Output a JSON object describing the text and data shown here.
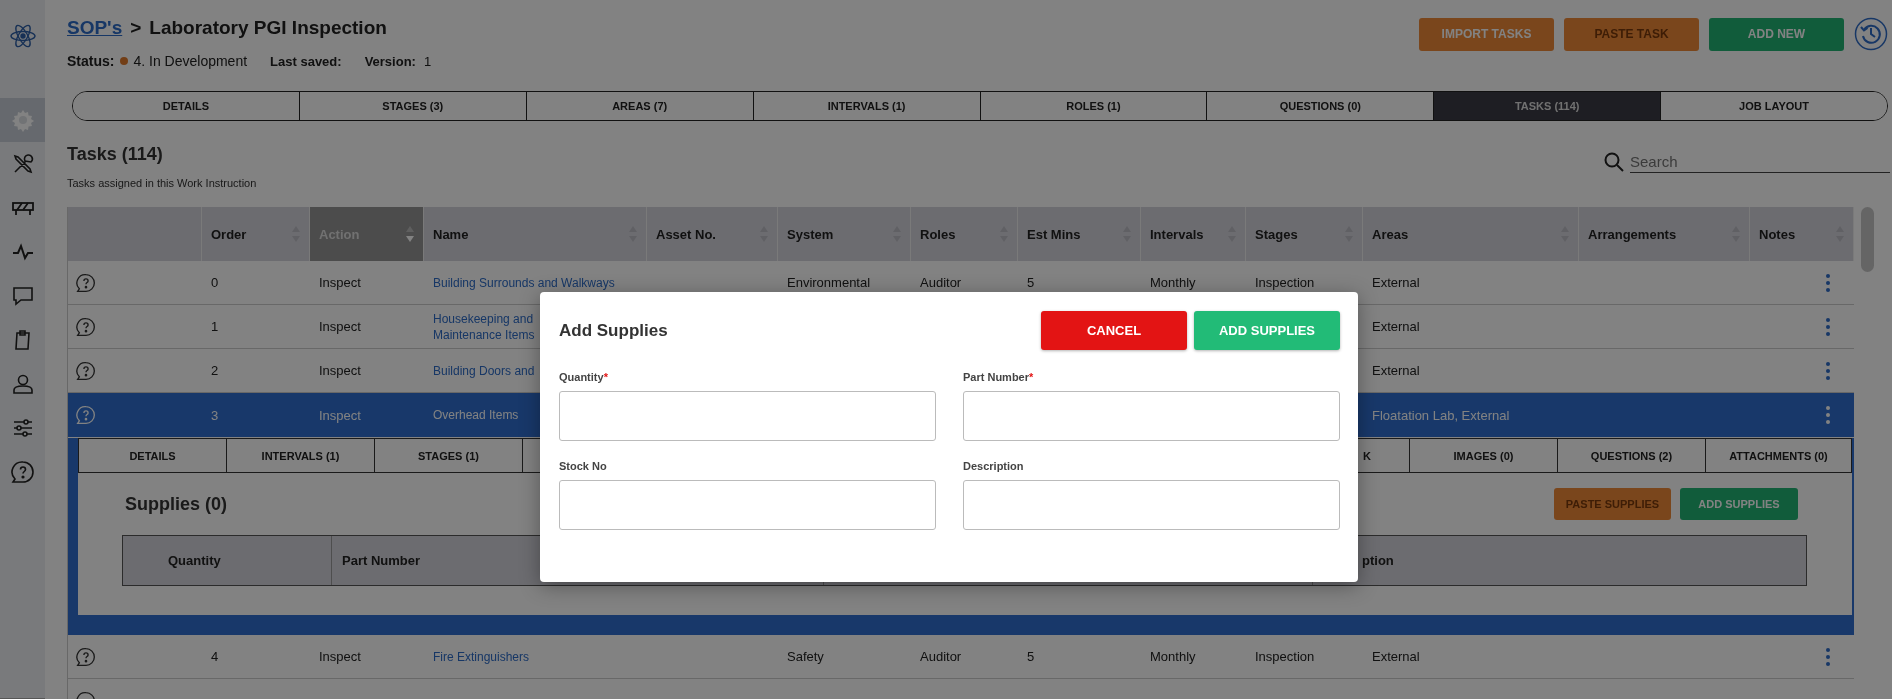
{
  "breadcrumb": {
    "link": "SOP's",
    "separator": ">",
    "title": "Laboratory PGI Inspection"
  },
  "status": {
    "label": "Status:",
    "value": "4. In Development",
    "last_saved_label": "Last saved:",
    "version_label": "Version:",
    "version": "1"
  },
  "actions": [
    {
      "label": "IMPORT TASKS",
      "kind": "orange",
      "disabled": false
    },
    {
      "label": "PASTE TASK",
      "kind": "orange",
      "disabled": true
    },
    {
      "label": "ADD NEW",
      "kind": "green",
      "disabled": false
    }
  ],
  "sidebar": {
    "items": [
      {
        "selected": true
      },
      {
        "selected": false
      },
      {
        "selected": false
      },
      {
        "selected": false
      },
      {
        "selected": false
      },
      {
        "selected": false
      },
      {
        "selected": false
      },
      {
        "selected": false
      },
      {
        "selected": false
      }
    ]
  },
  "tabs": [
    {
      "label": "DETAILS",
      "selected": false
    },
    {
      "label": "STAGES (3)",
      "selected": false
    },
    {
      "label": "AREAS (7)",
      "selected": false
    },
    {
      "label": "INTERVALS (1)",
      "selected": false
    },
    {
      "label": "ROLES (1)",
      "selected": false
    },
    {
      "label": "QUESTIONS (0)",
      "selected": false
    },
    {
      "label": "TASKS (114)",
      "selected": true
    },
    {
      "label": "JOB LAYOUT",
      "selected": false
    }
  ],
  "section": {
    "title": "Tasks (114)",
    "subtitle": "Tasks assigned in this Work Instruction"
  },
  "search": {
    "placeholder": "Search"
  },
  "table": {
    "columns": [
      {
        "label": "Order",
        "sorted": false
      },
      {
        "label": "Action",
        "sorted": true
      },
      {
        "label": "Name",
        "sorted": false
      },
      {
        "label": "Asset No.",
        "sorted": false
      },
      {
        "label": "System",
        "sorted": false
      },
      {
        "label": "Roles",
        "sorted": false
      },
      {
        "label": "Est Mins",
        "sorted": false
      },
      {
        "label": "Intervals",
        "sorted": false
      },
      {
        "label": "Stages",
        "sorted": false
      },
      {
        "label": "Areas",
        "sorted": false
      },
      {
        "label": "Arrangements",
        "sorted": false
      },
      {
        "label": "Notes",
        "sorted": false
      }
    ],
    "rows": [
      {
        "order": "0",
        "action": "Inspect",
        "name": "Building Surrounds and Walkways",
        "system": "Environmental",
        "roles": "Auditor",
        "est_mins": "5",
        "intervals": "Monthly",
        "stages": "Inspection",
        "areas": "External",
        "selected": false,
        "expanded": false
      },
      {
        "order": "1",
        "action": "Inspect",
        "name": "Housekeeping and\nMaintenance Items",
        "areas": "External",
        "selected": false,
        "expanded": false
      },
      {
        "order": "2",
        "action": "Inspect",
        "name": "Building Doors and",
        "areas": "External",
        "selected": false,
        "expanded": false
      },
      {
        "order": "3",
        "action": "Inspect",
        "name": "Overhead Items",
        "areas": "Floatation Lab, External",
        "selected": true,
        "expanded": true
      },
      {
        "order": "4",
        "action": "Inspect",
        "name": "Fire Extinguishers",
        "system": "Safety",
        "roles": "Auditor",
        "est_mins": "5",
        "intervals": "Monthly",
        "stages": "Inspection",
        "areas": "External",
        "selected": false,
        "expanded": false
      }
    ]
  },
  "details": {
    "tabs": [
      {
        "label": "DETAILS",
        "clipped": false
      },
      {
        "label": "INTERVALS (1)",
        "clipped": false
      },
      {
        "label": "STAGES (1)",
        "clipped": false
      },
      {
        "label": "K",
        "clipped": true
      },
      {
        "label": "IMAGES (0)",
        "clipped": false
      },
      {
        "label": "QUESTIONS (2)",
        "clipped": false
      },
      {
        "label": "ATTACHMENTS (0)",
        "clipped": false
      }
    ],
    "title": "Supplies (0)",
    "actions": [
      {
        "label": "PASTE SUPPLIES",
        "kind": "orange",
        "disabled": true
      },
      {
        "label": "ADD SUPPLIES",
        "kind": "green",
        "disabled": false
      }
    ],
    "columns": [
      "Quantity",
      "Part Number"
    ],
    "last_column": "ption"
  },
  "modal": {
    "title": "Add Supplies",
    "cancel": "CANCEL",
    "submit": "ADD SUPPLIES",
    "fields": [
      {
        "label": "Quantity",
        "required_mark": "*"
      },
      {
        "label": "Part Number",
        "required_mark": "*"
      },
      {
        "label": "Stock No"
      },
      {
        "label": "Description"
      }
    ]
  }
}
